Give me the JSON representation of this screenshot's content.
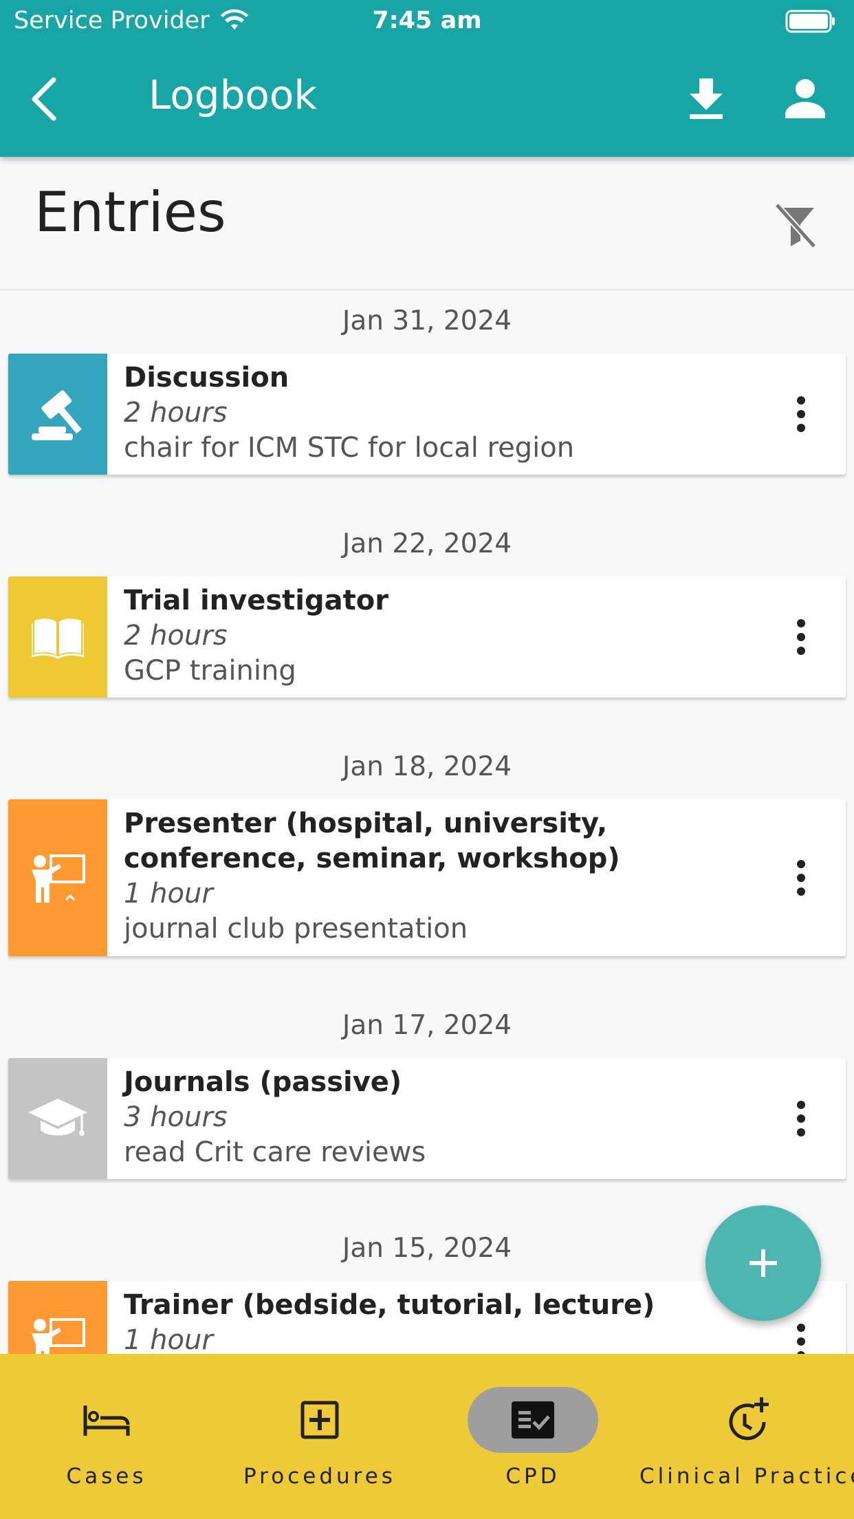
{
  "status_bar": {
    "carrier": "Service Provider",
    "time": "7:45 am"
  },
  "header": {
    "title": "Logbook"
  },
  "entries_title": "Entries",
  "entries": [
    {
      "date": "Jan 31, 2024",
      "title": "Discussion",
      "duration": "2 hours",
      "description": "chair for ICM STC for local region",
      "color": "#33a6be",
      "icon": "gavel-icon"
    },
    {
      "date": "Jan 22, 2024",
      "title": "Trial investigator",
      "duration": "2 hours",
      "description": "GCP training",
      "color": "#eec934",
      "icon": "book-icon"
    },
    {
      "date": "Jan 18, 2024",
      "title_line1": "Presenter (hospital, university,",
      "title_line2": "conference, seminar, workshop)",
      "duration": "1 hour",
      "description": "journal club presentation",
      "color": "#ff9a33",
      "icon": "presenter-icon"
    },
    {
      "date": "Jan 17, 2024",
      "title": "Journals (passive)",
      "duration": "3 hours",
      "description": "read Crit care reviews",
      "color": "#c4c4c4",
      "icon": "graduation-cap-icon"
    },
    {
      "date": "Jan 15, 2024",
      "title": "Trainer (bedside, tutorial, lecture)",
      "duration": "1 hour",
      "description": "",
      "color": "#ff9a33",
      "icon": "presenter-icon"
    }
  ],
  "nav": [
    {
      "label": "Cases",
      "icon": "bed-icon",
      "active": false
    },
    {
      "label": "Procedures",
      "icon": "plus-box-icon",
      "active": false
    },
    {
      "label": "CPD",
      "icon": "checklist-icon",
      "active": true
    },
    {
      "label": "Clinical Practice",
      "icon": "clock-plus-icon",
      "active": false
    }
  ],
  "colors": {
    "appbar": "#17a5a5",
    "bottom_nav": "#efca38",
    "fab": "#4db6b1"
  }
}
